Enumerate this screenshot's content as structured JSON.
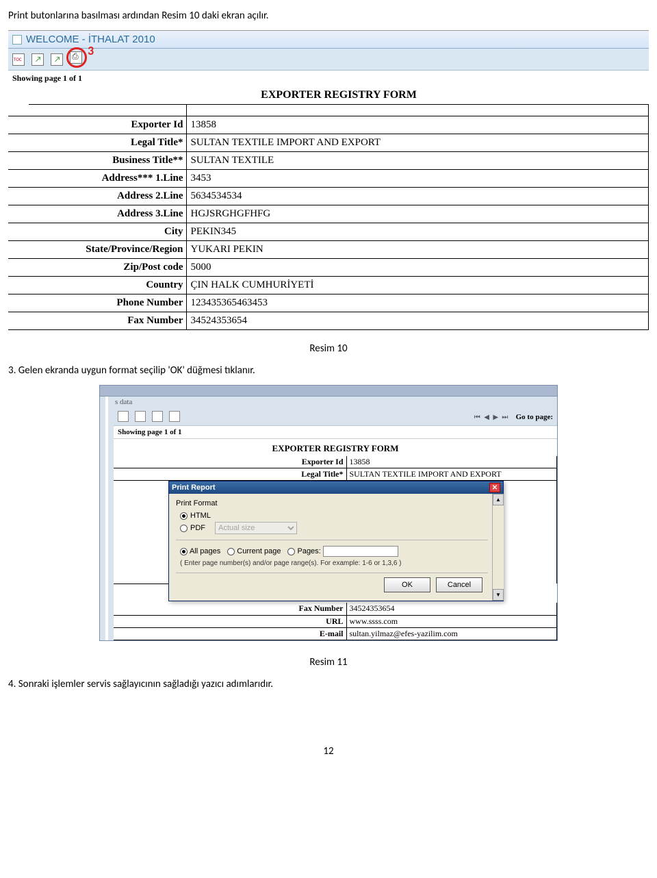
{
  "intro_text": "Print butonlarına basılması ardından Resim 10 daki ekran açılır.",
  "shot1": {
    "window_title": "WELCOME - İTHALAT 2010",
    "badge": "3",
    "pager": "Showing page  1  of  1",
    "form_title": "EXPORTER REGISTRY FORM",
    "rows": [
      {
        "label": "Exporter Id",
        "value": "13858"
      },
      {
        "label": "Legal Title*",
        "value": "SULTAN TEXTILE IMPORT AND EXPORT"
      },
      {
        "label": "Business Title**",
        "value": "SULTAN TEXTILE"
      },
      {
        "label": "Address*** 1.Line",
        "value": "3453"
      },
      {
        "label": "Address 2.Line",
        "value": "5634534534"
      },
      {
        "label": "Address 3.Line",
        "value": "HGJSRGHGFHFG"
      },
      {
        "label": "City",
        "value": "PEKIN345"
      },
      {
        "label": "State/Province/Region",
        "value": "YUKARI PEKIN"
      },
      {
        "label": "Zip/Post code",
        "value": "5000"
      },
      {
        "label": "Country",
        "value": "ÇIN HALK CUMHURİYETİ"
      },
      {
        "label": "Phone Number",
        "value": "123435365463453"
      },
      {
        "label": "Fax Number",
        "value": "34524353654"
      }
    ]
  },
  "caption1": "Resim 10",
  "step3_text": "3. Gelen ekranda uygun format seçilip 'OK' düğmesi tıklanır.",
  "shot2": {
    "s_data": "s data",
    "goto_label": "Go to page:",
    "pager": "Showing page  1  of  1",
    "form_title": "EXPORTER REGISTRY FORM",
    "top_rows": [
      {
        "label": "Exporter Id",
        "value": "13858"
      },
      {
        "label": "Legal Title*",
        "value": "SULTAN TEXTILE IMPORT AND EXPORT"
      }
    ],
    "bottom_rows": [
      {
        "label": "Fax Number",
        "value": "34524353654"
      },
      {
        "label": "URL",
        "value": "www.ssss.com"
      },
      {
        "label": "E-mail",
        "value": "sultan.yilmaz@efes-yazilim.com"
      }
    ]
  },
  "dialog": {
    "title": "Print Report",
    "section_label": "Print Format",
    "fmt_html": "HTML",
    "fmt_pdf": "PDF",
    "pdf_size": "Actual size",
    "pg_all": "All pages",
    "pg_current": "Current page",
    "pg_pages": "Pages:",
    "hint": "( Enter page number(s) and/or page range(s). For example: 1-6 or 1,3,6 )",
    "ok": "OK",
    "cancel": "Cancel"
  },
  "caption2": "Resim 11",
  "step4_text": "4. Sonraki işlemler servis sağlayıcının sağladığı yazıcı adımlarıdır.",
  "page_number": "12"
}
